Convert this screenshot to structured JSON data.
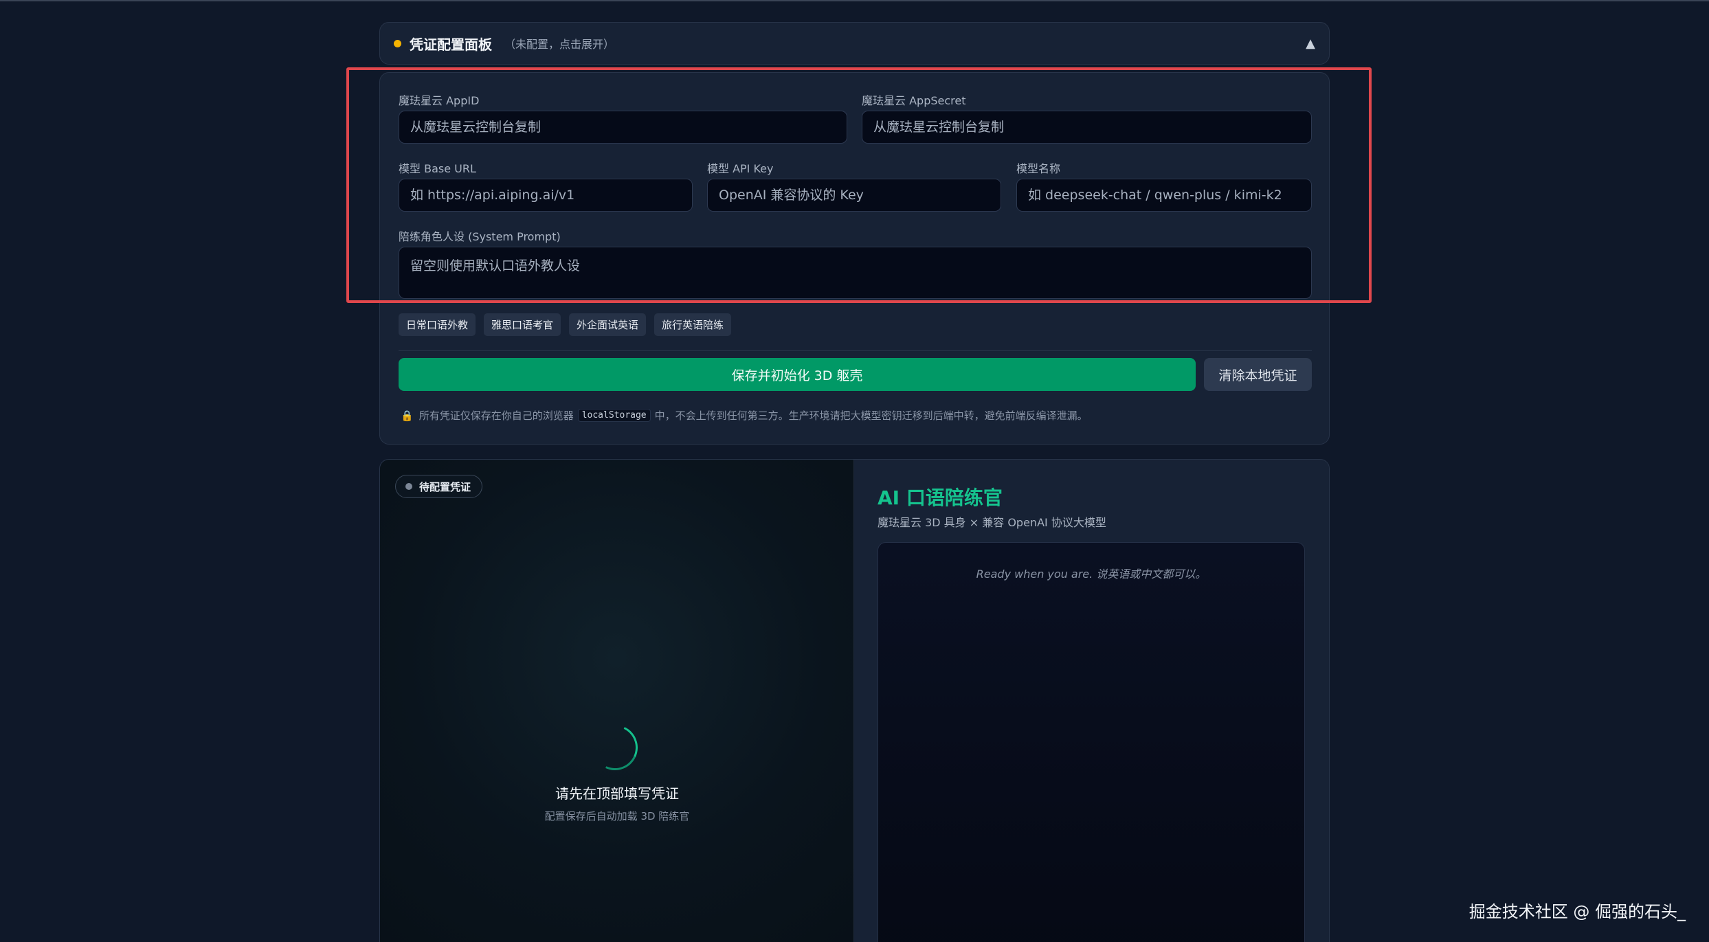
{
  "config_header": {
    "title": "凭证配置面板",
    "subtitle": "（未配置，点击展开）",
    "caret": "▲"
  },
  "fields": {
    "appid": {
      "label": "魔珐星云 AppID",
      "placeholder": "从魔珐星云控制台复制"
    },
    "appsecret": {
      "label": "魔珐星云 AppSecret",
      "placeholder": "从魔珐星云控制台复制"
    },
    "base_url": {
      "label": "模型 Base URL",
      "placeholder": "如 https://api.aiping.ai/v1"
    },
    "api_key": {
      "label": "模型 API Key",
      "placeholder": "OpenAI 兼容协议的 Key"
    },
    "model_name": {
      "label": "模型名称",
      "placeholder": "如 deepseek-chat / qwen-plus / kimi-k2"
    },
    "system_prompt": {
      "label": "陪练角色人设 (System Prompt)",
      "placeholder": "留空则使用默认口语外教人设"
    }
  },
  "presets": [
    "日常口语外教",
    "雅思口语考官",
    "外企面试英语",
    "旅行英语陪练"
  ],
  "actions": {
    "save_label": "保存并初始化 3D 躯壳",
    "clear_label": "清除本地凭证"
  },
  "notice": {
    "lock": "🔒",
    "before": "所有凭证仅保存在你自己的浏览器",
    "code": "localStorage",
    "after": "中，不会上传到任何第三方。生产环境请把大模型密钥迁移到后端中转，避免前端反编译泄漏。"
  },
  "stage": {
    "status": "待配置凭证",
    "message": "请先在顶部填写凭证",
    "sub": "配置保存后自动加载 3D 陪练官"
  },
  "chat": {
    "title": "AI 口语陪练官",
    "subtitle": "魔珐星云 3D 具身 × 兼容 OpenAI 协议大模型",
    "hint": "Ready when you are. 说英语或中文都可以。"
  },
  "watermark": "掘金技术社区 @ 倔强的石头_",
  "colors": {
    "accent_green": "#019966",
    "title_green": "#15c38e",
    "status_yellow": "#f5b301",
    "highlight_red": "#e0474c",
    "background": "#0f1829"
  }
}
